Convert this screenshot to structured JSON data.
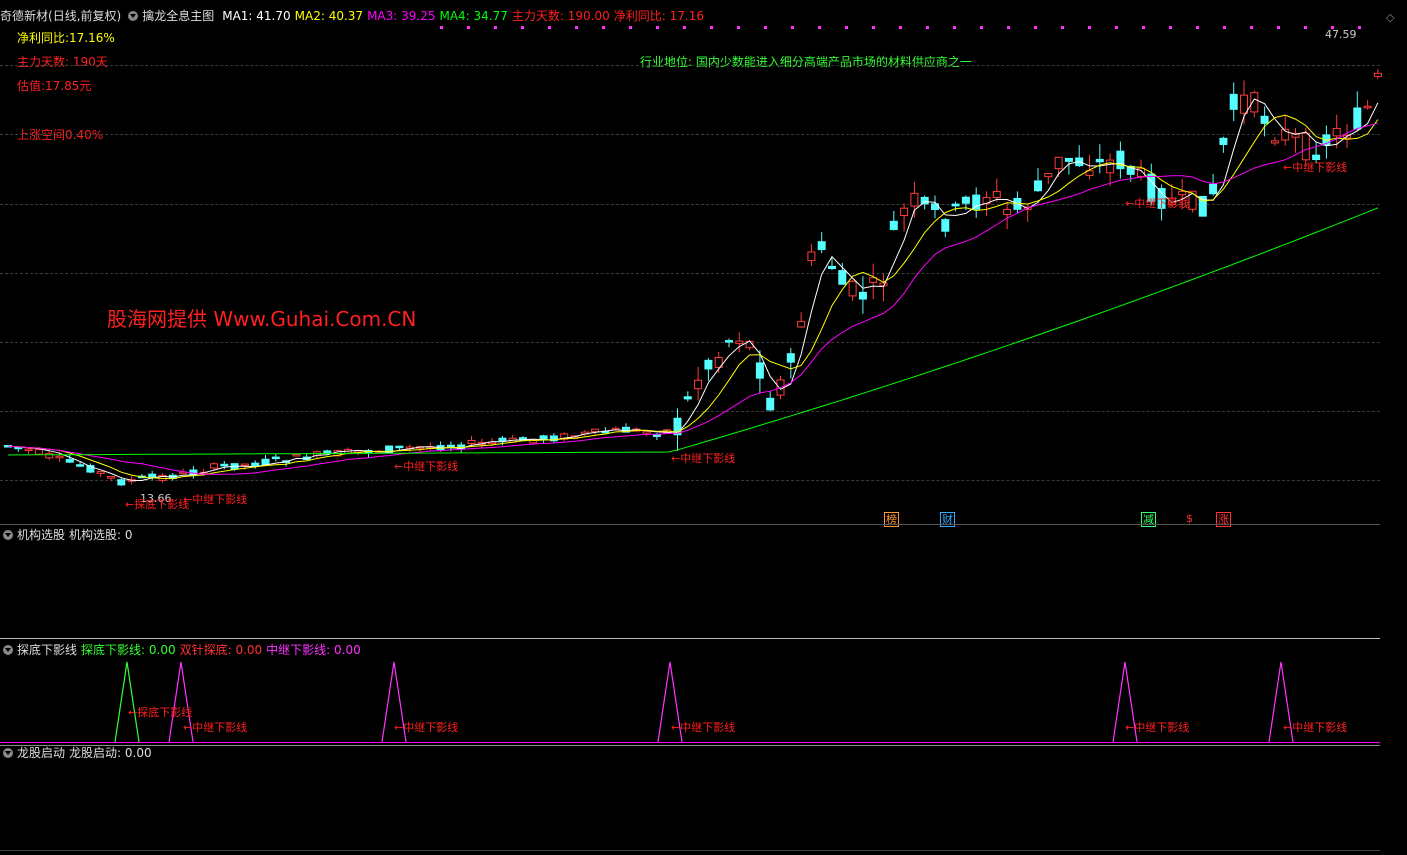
{
  "main_header": {
    "stock_name": "奇德新材",
    "period": "(日线,前复权)",
    "indicator": "擒龙全息主图",
    "items": [
      {
        "label": "MA1: 41.70",
        "color": "#ffffff"
      },
      {
        "label": "MA2: 40.37",
        "color": "#ffff00"
      },
      {
        "label": "MA3: 39.25",
        "color": "#ff00ff"
      },
      {
        "label": "MA4: 34.77",
        "color": "#00ff00"
      },
      {
        "label": "主力天数: 190.00",
        "color": "#ff2020"
      },
      {
        "label": "净利同比: 17.16",
        "color": "#ff2020"
      }
    ]
  },
  "info": {
    "net_profit": "净利同比:17.16%",
    "days": "主力天数: 190天",
    "valuation": "估值:17.85元",
    "upside": "上涨空间0.40%",
    "industry": "行业地位: 国内少数能进入细分高端产品市场的材料供应商之一"
  },
  "watermark": "股海网提供 Www.Guhai.Com.CN",
  "price_labels": {
    "high": "47.59",
    "low": "13.66"
  },
  "signals": {
    "tandi": "←探底下影线",
    "zhongji": "←中继下影线"
  },
  "badges": [
    {
      "label": "榜",
      "color": "#ff9933"
    },
    {
      "label": "财",
      "color": "#33aaff"
    },
    {
      "label": "减",
      "color": "#33ff66"
    },
    {
      "label": "$",
      "color": "#ff3333"
    },
    {
      "label": "涨",
      "color": "#ff3333"
    }
  ],
  "panel1": {
    "title": "机构选股",
    "value": "机构选股: 0"
  },
  "panel2": {
    "title": "探底下影线",
    "items": [
      {
        "label": "探底下影线: 0.00",
        "color": "#33ff33"
      },
      {
        "label": "双针探底: 0.00",
        "color": "#ff3333"
      },
      {
        "label": "中继下影线: 0.00",
        "color": "#ff33ff"
      }
    ]
  },
  "panel3": {
    "title": "龙股启动",
    "value": "龙股启动: 0.00"
  },
  "colors": {
    "up": "#ff3b3b",
    "down": "#55ffff",
    "ma1": "#ffffff",
    "ma2": "#ffff00",
    "ma3": "#ff00ff",
    "ma4": "#00ff00"
  }
}
